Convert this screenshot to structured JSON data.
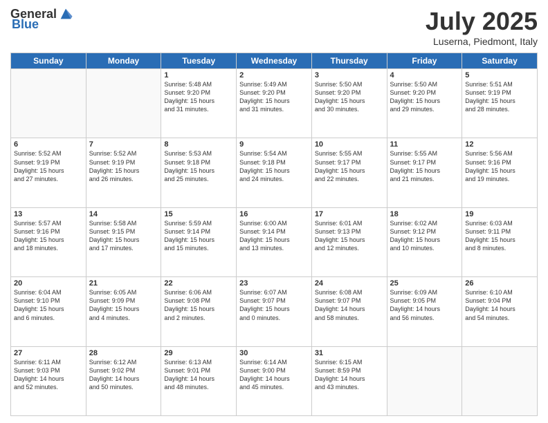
{
  "header": {
    "logo_general": "General",
    "logo_blue": "Blue",
    "month": "July 2025",
    "location": "Luserna, Piedmont, Italy"
  },
  "weekdays": [
    "Sunday",
    "Monday",
    "Tuesday",
    "Wednesday",
    "Thursday",
    "Friday",
    "Saturday"
  ],
  "weeks": [
    [
      {
        "day": "",
        "info": ""
      },
      {
        "day": "",
        "info": ""
      },
      {
        "day": "1",
        "info": "Sunrise: 5:48 AM\nSunset: 9:20 PM\nDaylight: 15 hours\nand 31 minutes."
      },
      {
        "day": "2",
        "info": "Sunrise: 5:49 AM\nSunset: 9:20 PM\nDaylight: 15 hours\nand 31 minutes."
      },
      {
        "day": "3",
        "info": "Sunrise: 5:50 AM\nSunset: 9:20 PM\nDaylight: 15 hours\nand 30 minutes."
      },
      {
        "day": "4",
        "info": "Sunrise: 5:50 AM\nSunset: 9:20 PM\nDaylight: 15 hours\nand 29 minutes."
      },
      {
        "day": "5",
        "info": "Sunrise: 5:51 AM\nSunset: 9:19 PM\nDaylight: 15 hours\nand 28 minutes."
      }
    ],
    [
      {
        "day": "6",
        "info": "Sunrise: 5:52 AM\nSunset: 9:19 PM\nDaylight: 15 hours\nand 27 minutes."
      },
      {
        "day": "7",
        "info": "Sunrise: 5:52 AM\nSunset: 9:19 PM\nDaylight: 15 hours\nand 26 minutes."
      },
      {
        "day": "8",
        "info": "Sunrise: 5:53 AM\nSunset: 9:18 PM\nDaylight: 15 hours\nand 25 minutes."
      },
      {
        "day": "9",
        "info": "Sunrise: 5:54 AM\nSunset: 9:18 PM\nDaylight: 15 hours\nand 24 minutes."
      },
      {
        "day": "10",
        "info": "Sunrise: 5:55 AM\nSunset: 9:17 PM\nDaylight: 15 hours\nand 22 minutes."
      },
      {
        "day": "11",
        "info": "Sunrise: 5:55 AM\nSunset: 9:17 PM\nDaylight: 15 hours\nand 21 minutes."
      },
      {
        "day": "12",
        "info": "Sunrise: 5:56 AM\nSunset: 9:16 PM\nDaylight: 15 hours\nand 19 minutes."
      }
    ],
    [
      {
        "day": "13",
        "info": "Sunrise: 5:57 AM\nSunset: 9:16 PM\nDaylight: 15 hours\nand 18 minutes."
      },
      {
        "day": "14",
        "info": "Sunrise: 5:58 AM\nSunset: 9:15 PM\nDaylight: 15 hours\nand 17 minutes."
      },
      {
        "day": "15",
        "info": "Sunrise: 5:59 AM\nSunset: 9:14 PM\nDaylight: 15 hours\nand 15 minutes."
      },
      {
        "day": "16",
        "info": "Sunrise: 6:00 AM\nSunset: 9:14 PM\nDaylight: 15 hours\nand 13 minutes."
      },
      {
        "day": "17",
        "info": "Sunrise: 6:01 AM\nSunset: 9:13 PM\nDaylight: 15 hours\nand 12 minutes."
      },
      {
        "day": "18",
        "info": "Sunrise: 6:02 AM\nSunset: 9:12 PM\nDaylight: 15 hours\nand 10 minutes."
      },
      {
        "day": "19",
        "info": "Sunrise: 6:03 AM\nSunset: 9:11 PM\nDaylight: 15 hours\nand 8 minutes."
      }
    ],
    [
      {
        "day": "20",
        "info": "Sunrise: 6:04 AM\nSunset: 9:10 PM\nDaylight: 15 hours\nand 6 minutes."
      },
      {
        "day": "21",
        "info": "Sunrise: 6:05 AM\nSunset: 9:09 PM\nDaylight: 15 hours\nand 4 minutes."
      },
      {
        "day": "22",
        "info": "Sunrise: 6:06 AM\nSunset: 9:08 PM\nDaylight: 15 hours\nand 2 minutes."
      },
      {
        "day": "23",
        "info": "Sunrise: 6:07 AM\nSunset: 9:07 PM\nDaylight: 15 hours\nand 0 minutes."
      },
      {
        "day": "24",
        "info": "Sunrise: 6:08 AM\nSunset: 9:07 PM\nDaylight: 14 hours\nand 58 minutes."
      },
      {
        "day": "25",
        "info": "Sunrise: 6:09 AM\nSunset: 9:05 PM\nDaylight: 14 hours\nand 56 minutes."
      },
      {
        "day": "26",
        "info": "Sunrise: 6:10 AM\nSunset: 9:04 PM\nDaylight: 14 hours\nand 54 minutes."
      }
    ],
    [
      {
        "day": "27",
        "info": "Sunrise: 6:11 AM\nSunset: 9:03 PM\nDaylight: 14 hours\nand 52 minutes."
      },
      {
        "day": "28",
        "info": "Sunrise: 6:12 AM\nSunset: 9:02 PM\nDaylight: 14 hours\nand 50 minutes."
      },
      {
        "day": "29",
        "info": "Sunrise: 6:13 AM\nSunset: 9:01 PM\nDaylight: 14 hours\nand 48 minutes."
      },
      {
        "day": "30",
        "info": "Sunrise: 6:14 AM\nSunset: 9:00 PM\nDaylight: 14 hours\nand 45 minutes."
      },
      {
        "day": "31",
        "info": "Sunrise: 6:15 AM\nSunset: 8:59 PM\nDaylight: 14 hours\nand 43 minutes."
      },
      {
        "day": "",
        "info": ""
      },
      {
        "day": "",
        "info": ""
      }
    ]
  ]
}
